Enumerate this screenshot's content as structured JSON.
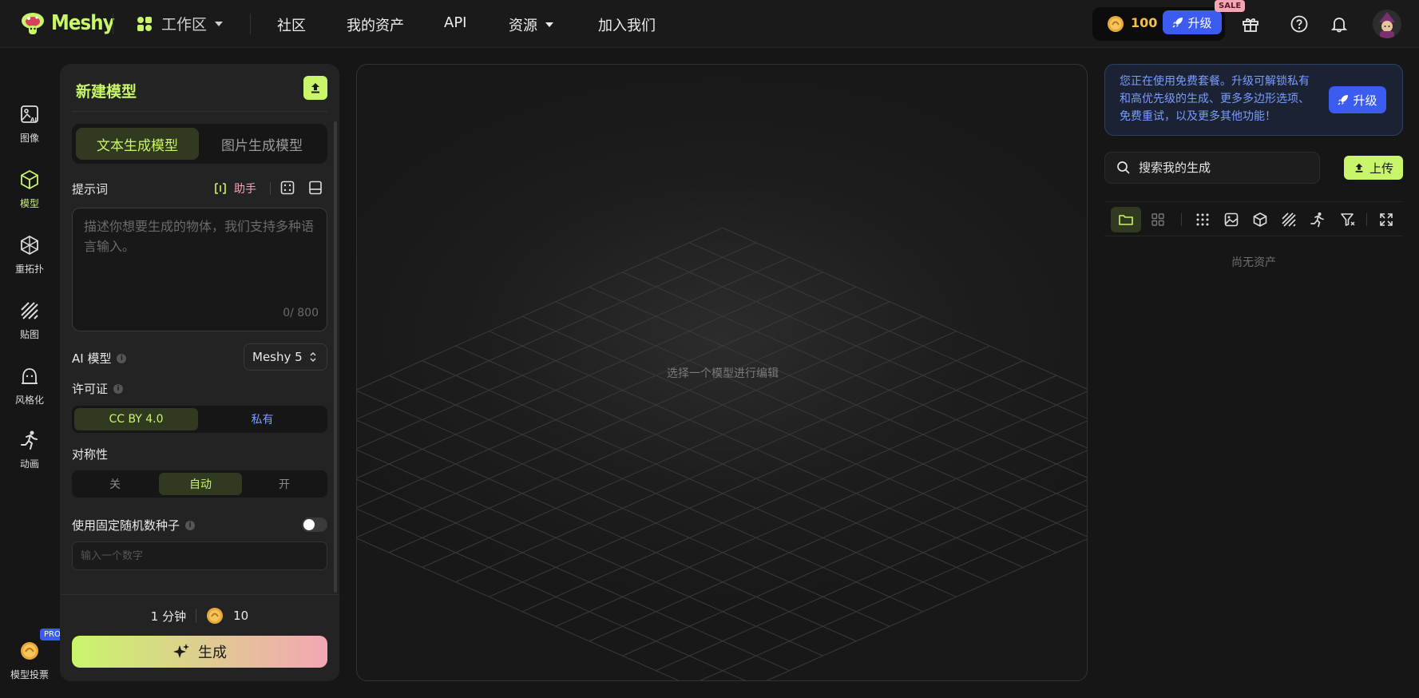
{
  "app": {
    "logo_text": "Meshy",
    "accent_color": "#c9f56b",
    "pink_color": "#f3a6b4",
    "blue_color": "#3c5cf0"
  },
  "nav": {
    "workspace": "工作区",
    "items": [
      "社区",
      "我的资产",
      "API",
      "资源",
      "加入我们"
    ]
  },
  "header": {
    "credits": "100",
    "upgrade": "升级",
    "sale": "SALE",
    "icons": [
      "gift-icon",
      "help-icon",
      "bell-icon"
    ]
  },
  "rail": {
    "items": [
      {
        "label": "图像",
        "icon": "ai-image-icon"
      },
      {
        "label": "模型",
        "icon": "cube-icon"
      },
      {
        "label": "重拓扑",
        "icon": "topology-icon"
      },
      {
        "label": "贴图",
        "icon": "texture-icon"
      },
      {
        "label": "风格化",
        "icon": "stylize-icon"
      },
      {
        "label": "动画",
        "icon": "running-icon"
      }
    ],
    "vote": {
      "label": "模型投票",
      "badge": "PRO"
    }
  },
  "panel": {
    "title": "新建模型",
    "tabs": [
      "文本生成模型",
      "图片生成模型"
    ],
    "prompt_label": "提示词",
    "assistant": "助手",
    "prompt_placeholder": "描述你想要生成的物体，我们支持多种语言输入。",
    "prompt_value": "",
    "counter": "0/ 800",
    "ai_model_label": "AI 模型",
    "ai_model_value": "Meshy 5",
    "license_label": "许可证",
    "license_options": [
      "CC BY 4.0",
      "私有"
    ],
    "symmetry_label": "对称性",
    "symmetry_options": [
      "关",
      "自动",
      "开"
    ],
    "seed_label": "使用固定随机数种子",
    "seed_placeholder": "输入一个数字",
    "time": "1 分钟",
    "cost": "10",
    "generate": "生成"
  },
  "viewport": {
    "hint": "选择一个模型进行编辑"
  },
  "right": {
    "promo": "您正在使用免费套餐。升级可解锁私有和高优先级的生成、更多多边形选项、免费重试，以及更多其他功能！",
    "promo_button": "升级",
    "search_placeholder": "搜索我的生成",
    "upload": "上传",
    "empty": "尚无资产"
  }
}
